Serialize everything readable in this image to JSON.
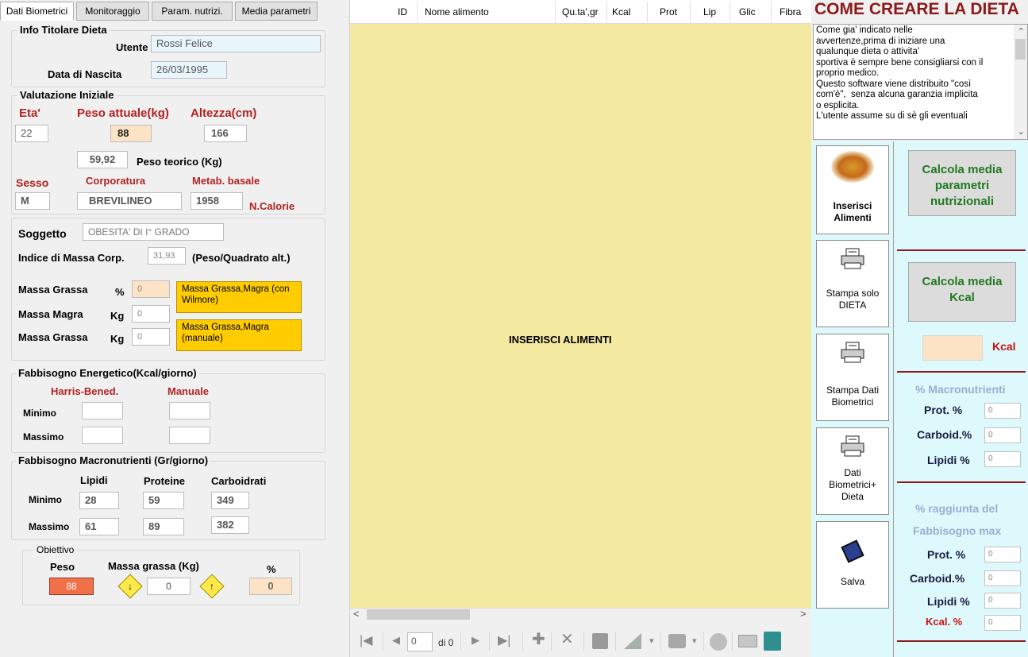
{
  "tabs": [
    "Dati Biometrici",
    "Monitoraggio",
    "Param. nutrizi.",
    "Media parametri"
  ],
  "info": {
    "title": "Info Titolare Dieta",
    "utente_label": "Utente",
    "utente_value": "Rossi Felice",
    "nascita_label": "Data di Nascita",
    "nascita_value": "26/03/1995"
  },
  "valutazione": {
    "title": "Valutazione Iniziale",
    "eta_label": "Eta'",
    "eta_value": "22",
    "peso_label": "Peso attuale(kg)",
    "peso_value": "88",
    "altezza_label": "Altezza(cm)",
    "altezza_value": "166",
    "peso_teorico_value": "59,92",
    "peso_teorico_label": "Peso teorico (Kg)",
    "sesso_label": "Sesso",
    "sesso_value": "M",
    "corporatura_label": "Corporatura",
    "corporatura_value": "BREVILINEO",
    "metab_label": "Metab. basale",
    "metab_value": "1958",
    "calorie_label": "N.Calorie"
  },
  "soggetto": {
    "label": "Soggetto",
    "value": "OBESITA' DI  I° GRADO",
    "imc_label": "Indice di Massa Corp.",
    "imc_value": "31,93",
    "imc_note": "(Peso/Quadrato alt.)",
    "mg1_label": "Massa Grassa",
    "mg1_unit": "%",
    "mg1_value": "0",
    "mm_label": "Massa Magra",
    "mm_unit": "Kg",
    "mm_value": "0",
    "mg2_label": "Massa Grassa",
    "mg2_unit": "Kg",
    "mg2_value": "0",
    "btn_wilmore": "Massa Grassa,Magra (con Wilmore)",
    "btn_manuale": "Massa Grassa,Magra (manuale)"
  },
  "fabbisogno_energetico": {
    "title": "Fabbisogno Energetico(Kcal/giorno)",
    "harris": "Harris-Bened.",
    "manuale": "Manuale",
    "minimo": "Minimo",
    "massimo": "Massimo"
  },
  "fabbisogno_macro": {
    "title": "Fabbisogno Macronutrienti (Gr/giorno)",
    "lipidi": "Lipidi",
    "proteine": "Proteine",
    "carboidrati": "Carboidrati",
    "minimo": "Minimo",
    "massimo": "Massimo",
    "min_values": [
      "28",
      "59",
      "349"
    ],
    "max_values": [
      "61",
      "89",
      "382"
    ]
  },
  "obiettivo": {
    "title": "Obiettivo",
    "peso_label": "Peso",
    "massa_label": "Massa grassa (Kg)",
    "pct_label": "%",
    "peso_value": "88",
    "massa_value": "0",
    "pct_value": "0"
  },
  "grid": {
    "columns": [
      "ID",
      "Nome alimento",
      "Qu.ta',gr",
      "Kcal",
      "Prot",
      "Lip",
      "Glic",
      "Fibra"
    ],
    "empty_message": "INSERISCI ALIMENTI",
    "nav_position": "0",
    "nav_total": "di 0"
  },
  "howto": {
    "title": "COME CREARE LA DIETA",
    "text": "Come gia' indicato nelle\navvertenze,prima di iniziare una\nqualunque dieta o attivita'\nsportiva è sempre bene consigliarsi con il\nproprio medico.\nQuesto software viene distribuito \"così\ncom'è\",  senza alcuna garanzia implicita\no esplicita.\nL'utente assume su di sè gli eventuali"
  },
  "side_buttons": {
    "inserisci": "Inserisci Alimenti",
    "stampa_dieta": "Stampa solo DIETA",
    "stampa_bio": "Stampa Dati Biometrici",
    "stampa_both": "Dati Biometrici+ Dieta",
    "salva": "Salva"
  },
  "right_panel": {
    "calc_param": "Calcola media parametri nutrizionali",
    "calc_kcal": "Calcola media Kcal",
    "kcal_label": "Kcal",
    "macro_title": "% Macronutrienti",
    "prot_label": "Prot. %",
    "prot_value": "0",
    "carb_label": "Carboid.%",
    "carb_value": "0",
    "lip_label": "Lipidi %",
    "lip_value": "0",
    "raggiunta_title1": "% raggiunta del",
    "raggiunta_title2": "Fabbisogno  max",
    "r_prot_label": "Prot. %",
    "r_prot_value": "0",
    "r_carb_label": "Carboid.%",
    "r_carb_value": "0",
    "r_lip_label": "Lipidi %",
    "r_lip_value": "0",
    "r_kcal_label": "Kcal. %",
    "r_kcal_value": "0"
  }
}
